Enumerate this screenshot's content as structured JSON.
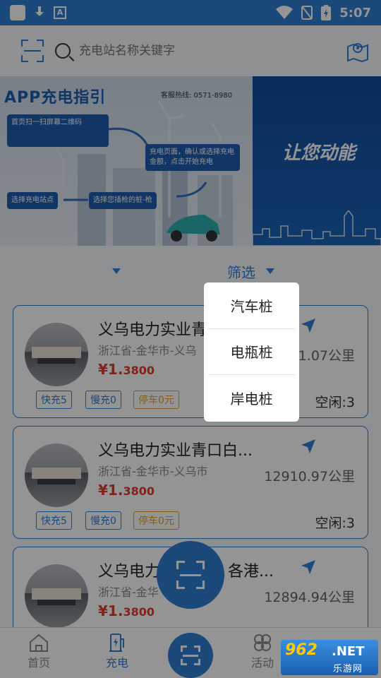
{
  "status_bar": {
    "time": "5:07",
    "colors": {
      "bar": "#2f7fd3"
    }
  },
  "search": {
    "placeholder": "充电站名称关键字"
  },
  "banner": {
    "left": {
      "title": "APP充电指引",
      "hotline": "客服热线: 0571-8980",
      "steps": [
        "首页扫一扫屏幕二维码",
        "充电页面，确认或选择充电金额，点击开始充电",
        "选择充电站点",
        "选择您插枪的桩-枪"
      ]
    },
    "right": {
      "slogan": "让您动能"
    }
  },
  "filter": {
    "label": "筛选"
  },
  "dropdown": {
    "items": [
      "汽车桩",
      "电瓶桩",
      "岸电桩"
    ]
  },
  "stations": [
    {
      "name": "义乌电力实业青",
      "address": "浙江省-金华市-义乌",
      "price_symbol": "¥1.",
      "price_decimal": "3800",
      "distance": "1.07公里",
      "tags": {
        "fast": "快充5",
        "slow": "慢充0",
        "park": "停车0元"
      },
      "idle": "空闲:3"
    },
    {
      "name": "义乌电力实业青口白...",
      "address": "浙江省-金华市-义乌市",
      "price_symbol": "¥1.",
      "price_decimal": "3800",
      "distance": "12910.97公里",
      "tags": {
        "fast": "快充5",
        "slow": "慢充0",
        "park": "停车0元"
      },
      "idle": "空闲:3"
    },
    {
      "name": "义乌电力",
      "name_suffix": "各港...",
      "address": "浙江省-金华",
      "price_symbol": "¥1.",
      "price_decimal": "3800",
      "distance": "12894.94公里"
    }
  ],
  "bottom_nav": {
    "home": "首页",
    "charge": "充电",
    "activity": "活动"
  },
  "watermark": {
    "brand": "962",
    "net": ".NET",
    "site": "乐游网"
  },
  "colors": {
    "accent": "#2f7fd3",
    "price": "#e23b2e",
    "park_tag": "#e5a02b"
  }
}
